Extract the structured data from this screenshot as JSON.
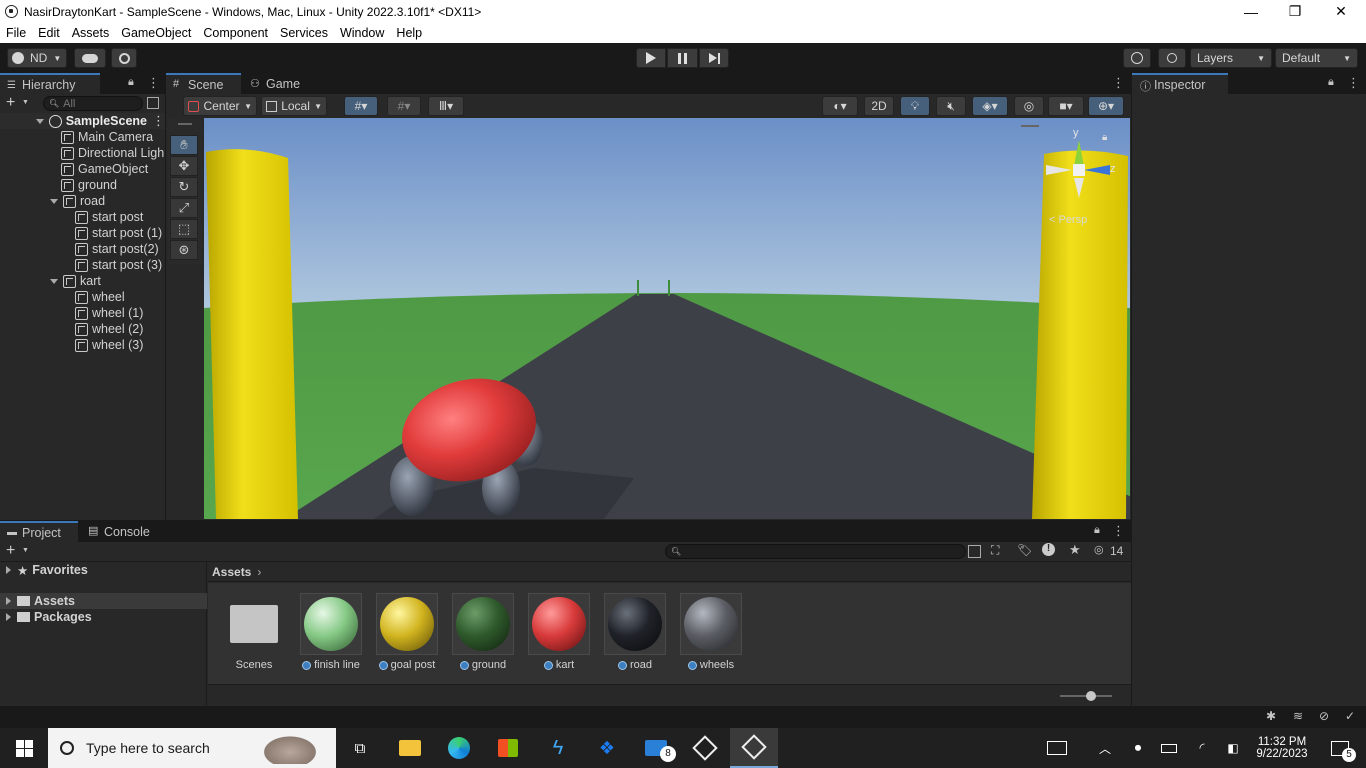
{
  "window": {
    "title": "NasirDraytonKart - SampleScene - Windows, Mac, Linux - Unity 2022.3.10f1* <DX11>",
    "minimize": "—",
    "restore": "❐",
    "close": "✕"
  },
  "menu": [
    "File",
    "Edit",
    "Assets",
    "GameObject",
    "Component",
    "Services",
    "Window",
    "Help"
  ],
  "toolbar": {
    "account": "ND",
    "layers": "Layers",
    "layout": "Default"
  },
  "hierarchy": {
    "tab": "Hierarchy",
    "search_placeholder": "All",
    "scene": "SampleScene",
    "items": [
      {
        "label": "Main Camera"
      },
      {
        "label": "Directional Ligh"
      },
      {
        "label": "GameObject"
      },
      {
        "label": "ground"
      },
      {
        "label": "road"
      },
      {
        "label": "start post"
      },
      {
        "label": "start post (1)"
      },
      {
        "label": "start post(2)"
      },
      {
        "label": "start post (3)"
      },
      {
        "label": "kart"
      },
      {
        "label": "wheel"
      },
      {
        "label": "wheel (1)"
      },
      {
        "label": "wheel (2)"
      },
      {
        "label": "wheel (3)"
      }
    ]
  },
  "scene": {
    "tab_scene": "Scene",
    "tab_game": "Game",
    "pivot": "Center",
    "space": "Local",
    "mode_2d": "2D",
    "gizmo_y": "y",
    "gizmo_z": "z",
    "persp": "< Persp"
  },
  "inspector": {
    "tab": "Inspector"
  },
  "project": {
    "tab_project": "Project",
    "tab_console": "Console",
    "favorites": "Favorites",
    "assets_folder": "Assets",
    "packages_folder": "Packages",
    "breadcrumb": "Assets",
    "hidden_count": "14",
    "assets": [
      {
        "label": "Scenes",
        "kind": "folder"
      },
      {
        "label": "finish line",
        "color": "#86c986"
      },
      {
        "label": "goal post",
        "color": "#d1b41f"
      },
      {
        "label": "ground",
        "color": "#2f5a2c"
      },
      {
        "label": "kart",
        "color": "#d83a3a"
      },
      {
        "label": "road",
        "color": "#1f2228"
      },
      {
        "label": "wheels",
        "color": "#5a5d63"
      }
    ]
  },
  "taskbar": {
    "search_placeholder": "Type here to search",
    "mail_badge": "8",
    "time": "11:32 PM",
    "date": "9/22/2023",
    "notif_count": "5"
  }
}
